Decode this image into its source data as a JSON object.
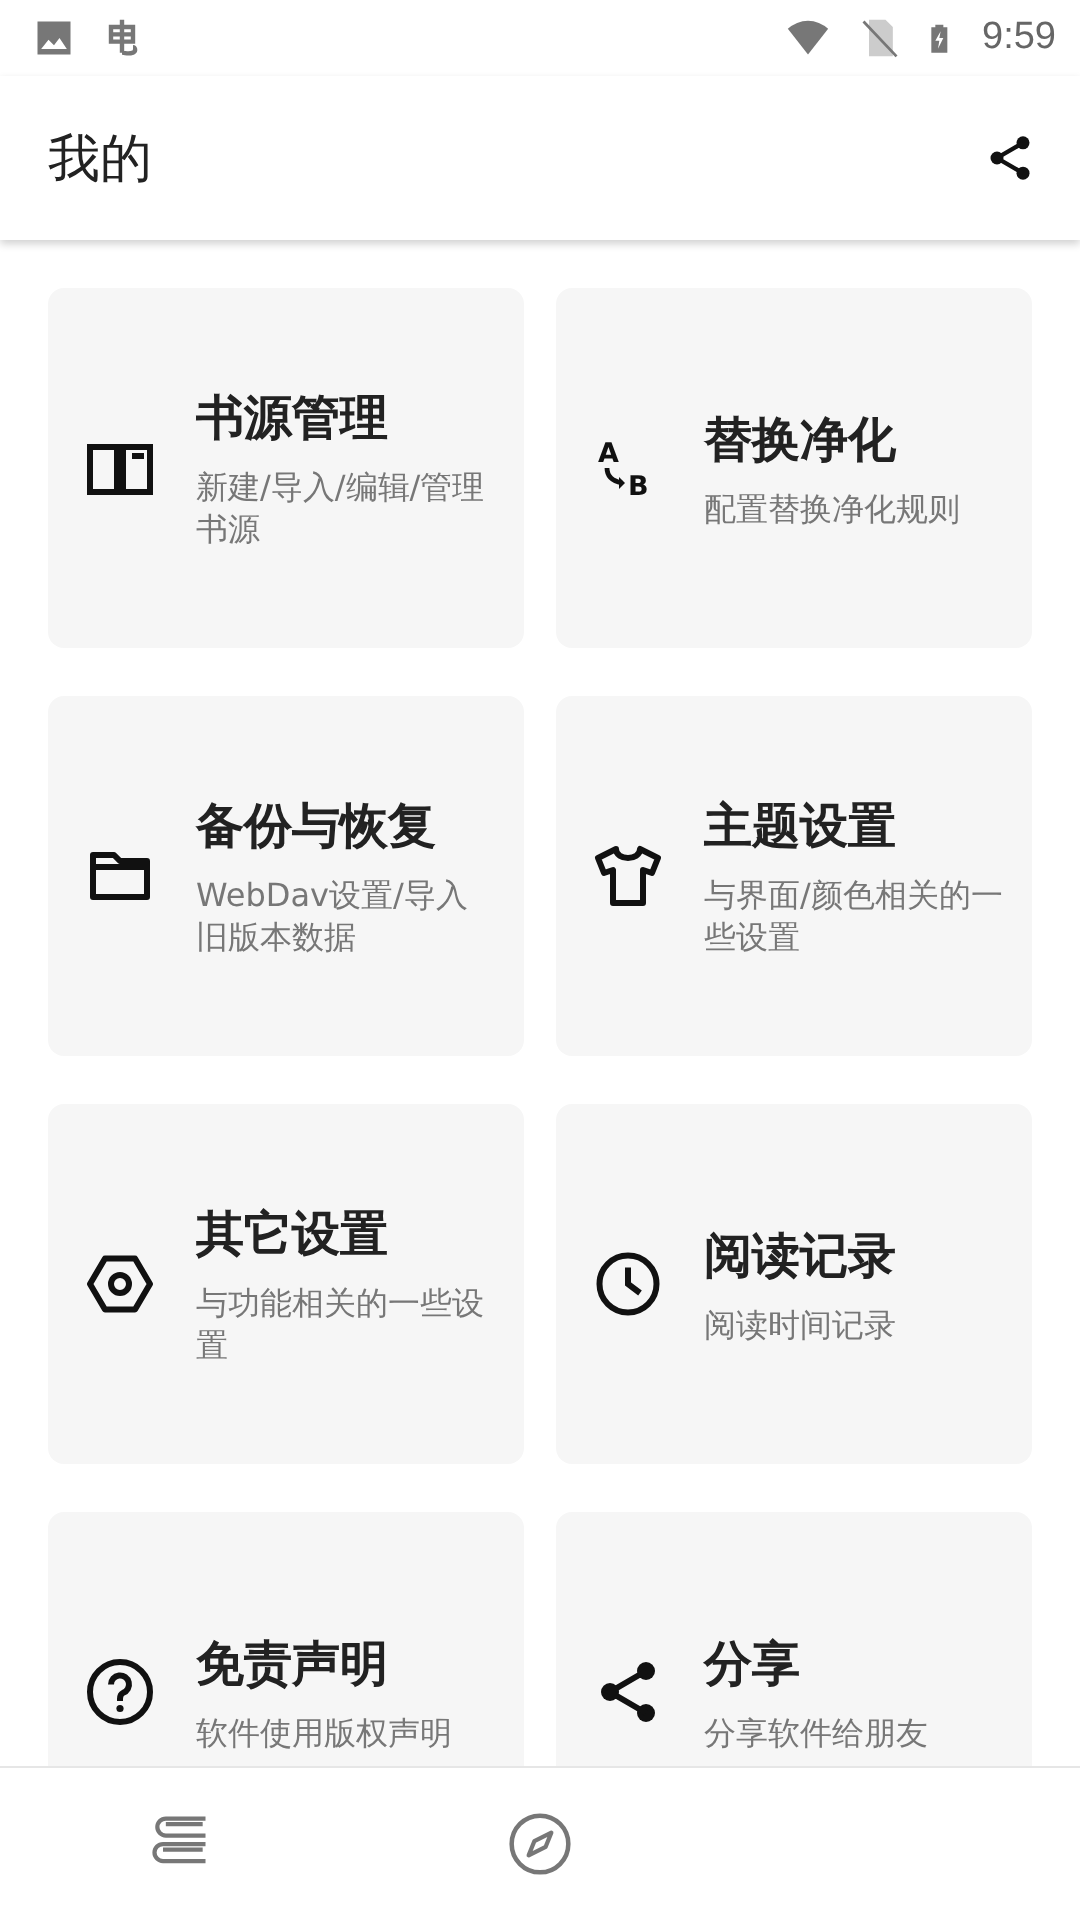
{
  "status_bar": {
    "time": "9:59"
  },
  "app_bar": {
    "title": "我的"
  },
  "cards": [
    {
      "title": "书源管理",
      "subtitle": "新建/导入/编辑/管理书源"
    },
    {
      "icon_letters": [
        "A",
        "B"
      ],
      "title": "替换净化",
      "subtitle": "配置替换净化规则"
    },
    {
      "title": "备份与恢复",
      "subtitle": "WebDav设置/导入旧版本数据"
    },
    {
      "title": "主题设置",
      "subtitle": "与界面/颜色相关的一些设置"
    },
    {
      "title": "其它设置",
      "subtitle": "与功能相关的一些设置"
    },
    {
      "title": "阅读记录",
      "subtitle": "阅读时间记录"
    },
    {
      "title": "免责声明",
      "subtitle": "软件使用版权声明"
    },
    {
      "title": "分享",
      "subtitle": "分享软件给朋友"
    }
  ]
}
